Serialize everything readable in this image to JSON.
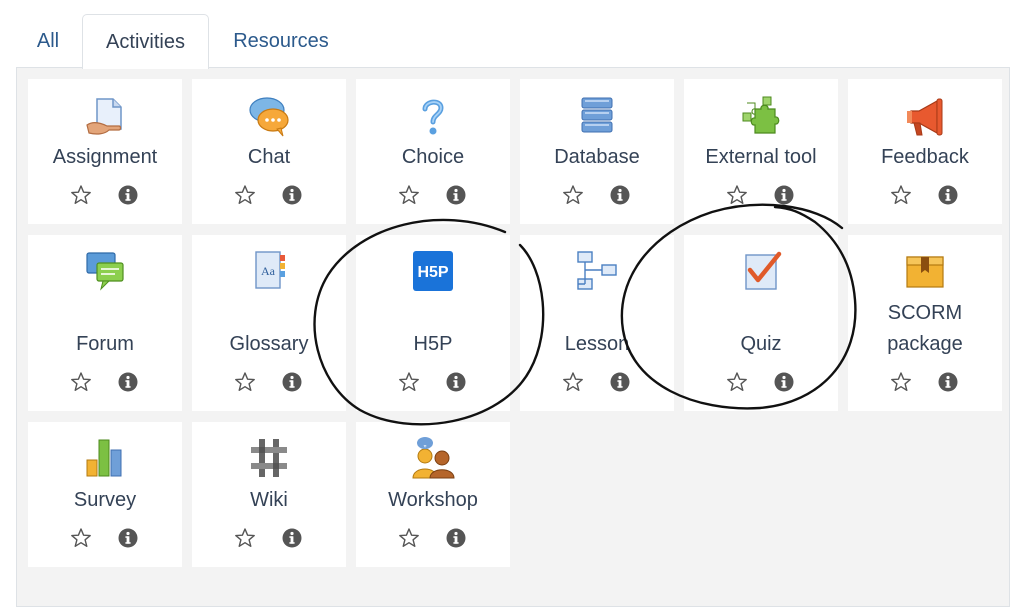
{
  "tabs": [
    {
      "label": "All"
    },
    {
      "label": "Activities",
      "active": true
    },
    {
      "label": "Resources"
    }
  ],
  "activities": [
    {
      "label": "Assignment",
      "icon": "assignment-icon"
    },
    {
      "label": "Chat",
      "icon": "chat-icon"
    },
    {
      "label": "Choice",
      "icon": "question-icon"
    },
    {
      "label": "Database",
      "icon": "database-icon"
    },
    {
      "label": "External tool",
      "icon": "puzzle-icon"
    },
    {
      "label": "Feedback",
      "icon": "megaphone-icon"
    },
    {
      "label": "Forum",
      "icon": "forum-icon"
    },
    {
      "label": "Glossary",
      "icon": "glossary-icon"
    },
    {
      "label": "H5P",
      "icon": "h5p-icon",
      "icon_text": "H5P"
    },
    {
      "label": "Lesson",
      "icon": "lesson-icon"
    },
    {
      "label": "Quiz",
      "icon": "quiz-icon"
    },
    {
      "label_line1": "SCORM",
      "label_line2": "package",
      "icon": "package-icon"
    },
    {
      "label": "Survey",
      "icon": "bar-chart-icon"
    },
    {
      "label": "Wiki",
      "icon": "wiki-icon"
    },
    {
      "label": "Workshop",
      "icon": "workshop-icon"
    }
  ],
  "colors": {
    "tab_link": "#2c5a8c",
    "text": "#344256",
    "panel_bg": "#f3f3f3",
    "card_bg": "#ffffff",
    "icon_dark": "#555555",
    "annotation": "#111111"
  }
}
